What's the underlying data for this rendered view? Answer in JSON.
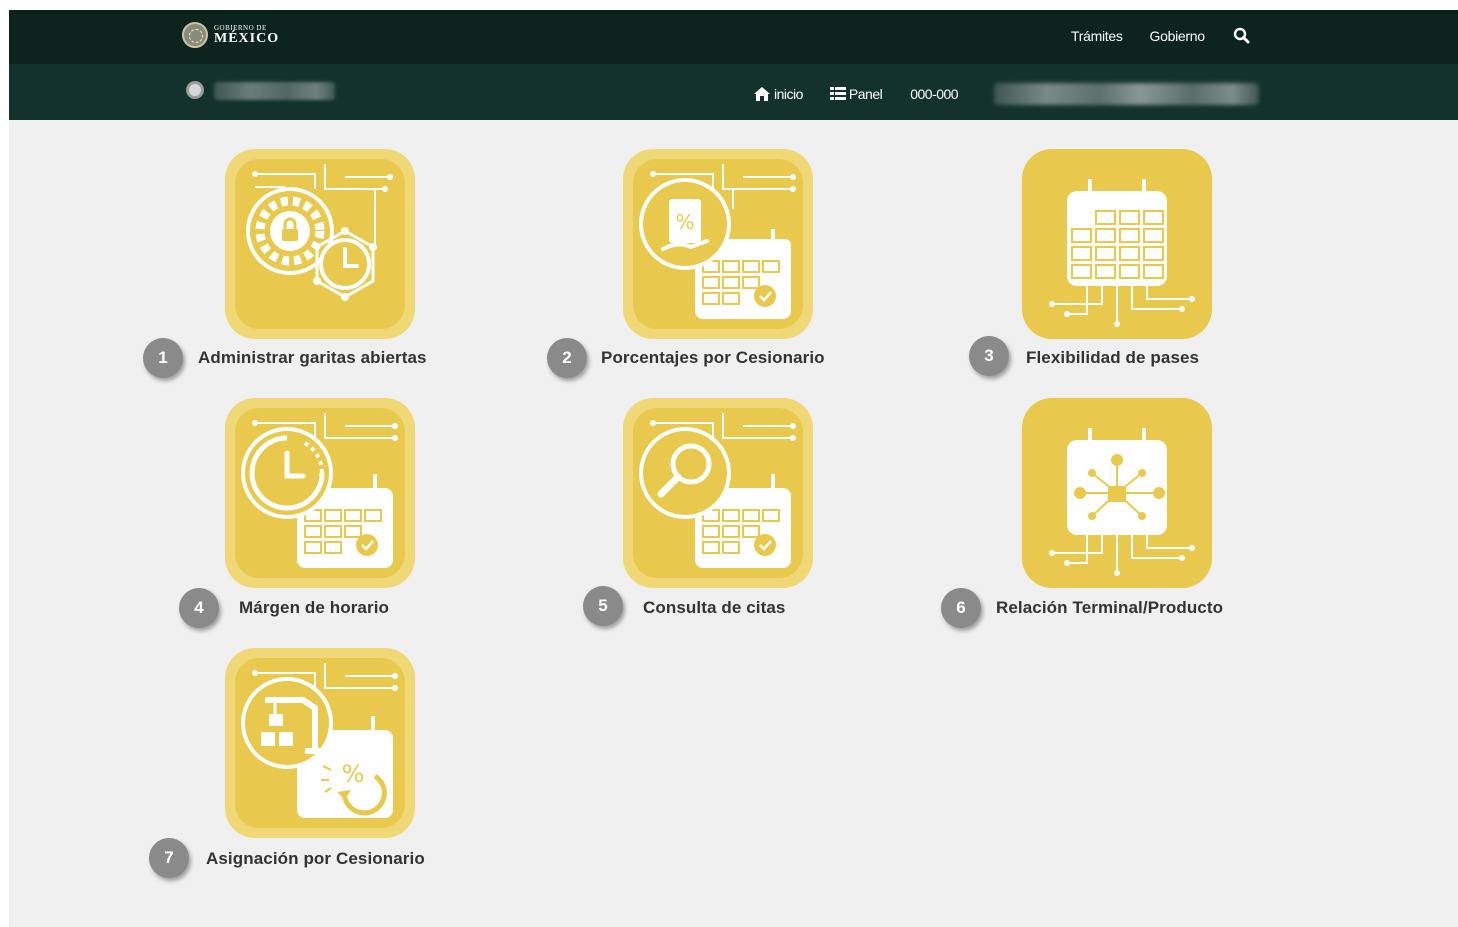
{
  "header": {
    "logo_small": "GOBIERNO DE",
    "logo_big": "MÉXICO",
    "nav": [
      "Trámites",
      "Gobierno"
    ],
    "search_icon": "search-icon"
  },
  "subheader": {
    "home_label": "inicio",
    "panel_label": "Panel",
    "code": "000-000"
  },
  "menu": [
    {
      "number": "1",
      "label": "Administrar garitas abiertas",
      "icon": "gear-lock-clock-icon"
    },
    {
      "number": "2",
      "label": "Porcentajes por Cesionario",
      "icon": "percent-calendar-icon"
    },
    {
      "number": "3",
      "label": "Flexibilidad de pases",
      "icon": "calendar-grid-icon"
    },
    {
      "number": "4",
      "label": "Márgen de horario",
      "icon": "clock-calendar-icon"
    },
    {
      "number": "5",
      "label": "Consulta de citas",
      "icon": "search-calendar-icon"
    },
    {
      "number": "6",
      "label": "Relación Terminal/Producto",
      "icon": "network-calendar-icon"
    },
    {
      "number": "7",
      "label": "Asignación por Cesionario",
      "icon": "crane-percent-calendar-icon"
    }
  ],
  "colors": {
    "topbar": "#0c231e",
    "subbar": "#13322b",
    "tile": "#e9c94d",
    "badge": "#8a8a8a",
    "page_bg": "#f0f0f0"
  }
}
